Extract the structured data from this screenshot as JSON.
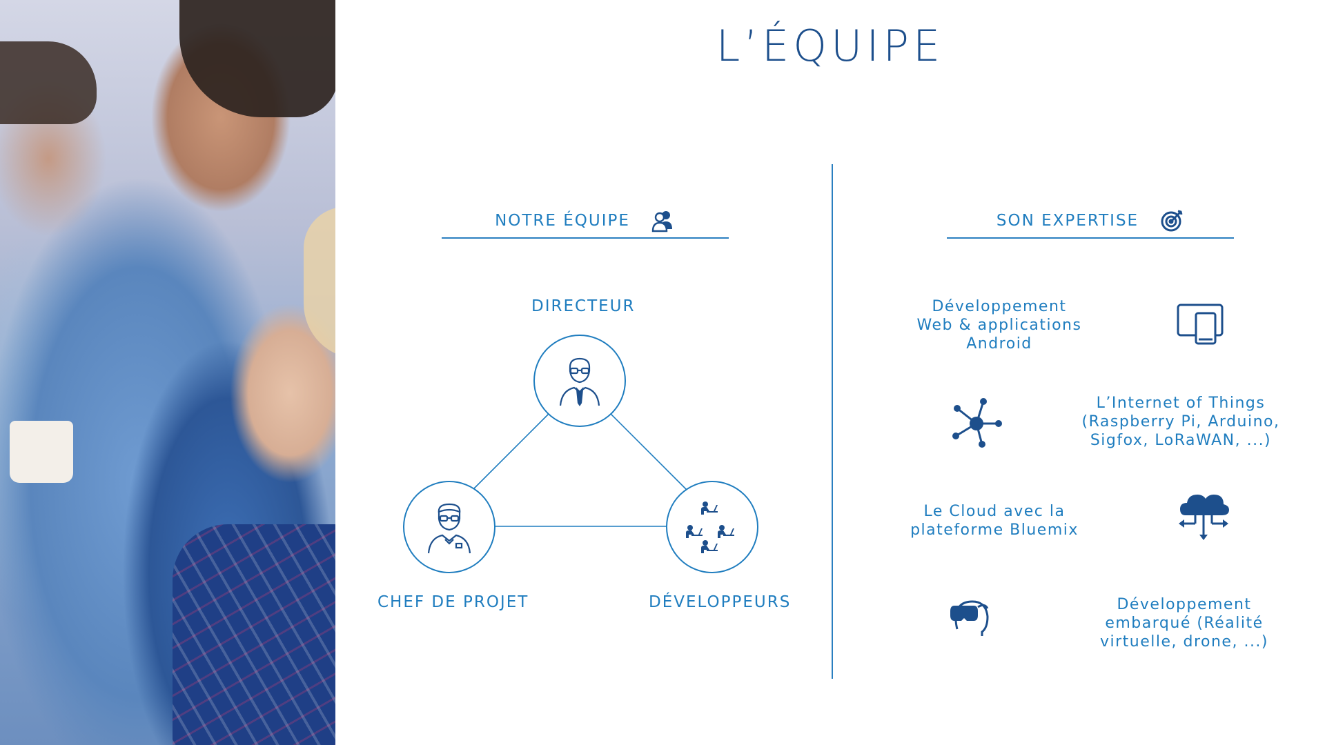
{
  "title": "L’ÉQUIPE",
  "colors": {
    "accent": "#1f7dbf",
    "title": "#1d4f8c",
    "icon": "#1d4f8c"
  },
  "team": {
    "header": "NOTRE ÉQUIPE",
    "header_icon": "team-people-icon",
    "roles": {
      "director": "DIRECTEUR",
      "project_manager": "CHEF DE PROJET",
      "developers": "DÉVELOPPEURS"
    }
  },
  "expertise": {
    "header": "SON EXPERTISE",
    "header_icon": "target-icon",
    "items": [
      {
        "lines": [
          "Développement",
          "Web & applications",
          "Android"
        ],
        "icon": "tablet-icon"
      },
      {
        "lines": [
          "L’Internet of Things",
          "(Raspberry Pi, Arduino,",
          "Sigfox, LoRaWAN, ...)"
        ],
        "icon": "network-hub-icon"
      },
      {
        "lines": [
          "Le Cloud avec la",
          "plateforme Bluemix"
        ],
        "icon": "cloud-arrows-icon"
      },
      {
        "lines": [
          "Développement",
          "embarqué (Réalité",
          "virtuelle, drone, ...)"
        ],
        "icon": "vr-headset-icon"
      }
    ]
  }
}
